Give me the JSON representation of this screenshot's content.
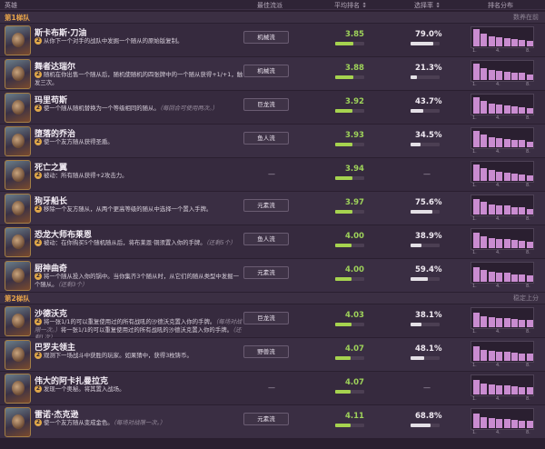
{
  "header": {
    "hero": "英雄",
    "comp": "最佳流派",
    "avg": "平均排名 ↕",
    "pick": "选择率 ↕",
    "dist": "排名分布"
  },
  "sections": [
    {
      "title": "第1梯队",
      "right": "数养在前"
    },
    {
      "title": "第2梯队",
      "right": "稳定上分"
    }
  ],
  "heroes": [
    {
      "name": "斯卡布斯·刀油",
      "desc": "从你下一个对手的战队中发掘一个随从的原始版复制。",
      "note": "",
      "comp": "机械流",
      "avg": "3.85",
      "avg_frac": 0.62,
      "pick": "79.0%",
      "pick_frac": 0.79,
      "dist": [
        0.95,
        0.7,
        0.55,
        0.5,
        0.45,
        0.4,
        0.35,
        0.3
      ]
    },
    {
      "name": "舞者达瑞尔",
      "desc": "随机在你出售一个随从后，随机使随机的四张牌中的一个随从获得+1/+1，触发三次。",
      "note": "",
      "comp": "机械流",
      "avg": "3.88",
      "avg_frac": 0.61,
      "pick": "21.3%",
      "pick_frac": 0.21,
      "dist": [
        0.9,
        0.65,
        0.55,
        0.5,
        0.45,
        0.42,
        0.38,
        0.3
      ]
    },
    {
      "name": "玛里苟斯",
      "desc": "使一个随从随机替换为一个等级相同的随从。",
      "note": "（每回合可使用两次。）",
      "comp": "巨龙流",
      "avg": "3.92",
      "avg_frac": 0.6,
      "pick": "43.7%",
      "pick_frac": 0.44,
      "dist": [
        0.9,
        0.68,
        0.55,
        0.48,
        0.45,
        0.42,
        0.35,
        0.28
      ]
    },
    {
      "name": "堕落的乔治",
      "desc": "使一个友方随从获得圣盾。",
      "note": "",
      "comp": "鱼人流",
      "avg": "3.93",
      "avg_frac": 0.6,
      "pick": "34.5%",
      "pick_frac": 0.35,
      "dist": [
        0.9,
        0.7,
        0.55,
        0.5,
        0.45,
        0.4,
        0.38,
        0.32
      ]
    },
    {
      "name": "死亡之翼",
      "desc": "被动：所有随从获得+2攻击力。",
      "note": "",
      "comp": "",
      "avg": "3.94",
      "avg_frac": 0.59,
      "pick": "",
      "pick_frac": 0,
      "dist": [
        0.88,
        0.7,
        0.58,
        0.5,
        0.45,
        0.42,
        0.35,
        0.3
      ]
    },
    {
      "name": "狗牙船长",
      "desc": "移除一个友方随从，从两个更高等级的随从中选择一个置入手牌。",
      "note": "",
      "comp": "元素流",
      "avg": "3.97",
      "avg_frac": 0.58,
      "pick": "75.6%",
      "pick_frac": 0.76,
      "dist": [
        0.85,
        0.68,
        0.55,
        0.5,
        0.48,
        0.42,
        0.38,
        0.32
      ]
    },
    {
      "name": "恐龙大师布莱恩",
      "desc": "被动：在你购买5个随机随从后，将布莱恩·铜须置入你的手牌。",
      "note": "（还剩5个）",
      "comp": "鱼人流",
      "avg": "4.00",
      "avg_frac": 0.56,
      "pick": "38.9%",
      "pick_frac": 0.39,
      "dist": [
        0.85,
        0.65,
        0.55,
        0.5,
        0.48,
        0.45,
        0.4,
        0.35
      ]
    },
    {
      "name": "厨神曲奇",
      "desc": "将一个随从投入你的锅中。当你集齐3个随从时，从它们的随从类型中发掘一个随从。",
      "note": "（还剩3个）",
      "comp": "元素流",
      "avg": "4.00",
      "avg_frac": 0.56,
      "pick": "59.4%",
      "pick_frac": 0.59,
      "dist": [
        0.82,
        0.65,
        0.55,
        0.52,
        0.48,
        0.42,
        0.4,
        0.35
      ]
    },
    {
      "name": "沙德沃克",
      "desc": "将一张1/1的可以重复使用过的所有战吼的沙德沃克置入你的手牌。",
      "note": "（每场对战限一次。）",
      "desc2": "将一张1/1的可以重复使用过的所有战吼的沙德沃克置入你的手牌。",
      "note2": "（还剩1次）",
      "comp": "巨龙流",
      "avg": "4.03",
      "avg_frac": 0.55,
      "pick": "38.1%",
      "pick_frac": 0.38,
      "dist": [
        0.82,
        0.62,
        0.55,
        0.5,
        0.48,
        0.45,
        0.42,
        0.38
      ]
    },
    {
      "name": "巴罗夫领主",
      "desc": "观测下一场战斗中获胜的玩家。如果猜中，获得3枚铸币。",
      "note": "",
      "comp": "野兽流",
      "avg": "4.07",
      "avg_frac": 0.53,
      "pick": "48.1%",
      "pick_frac": 0.48,
      "dist": [
        0.8,
        0.62,
        0.55,
        0.5,
        0.48,
        0.45,
        0.42,
        0.38
      ]
    },
    {
      "name": "伟大的阿卡扎曼拉克",
      "desc": "发现一个奥秘。将其置入战场。",
      "note": "",
      "comp": "",
      "avg": "4.07",
      "avg_frac": 0.53,
      "pick": "",
      "pick_frac": 0,
      "dist": [
        0.8,
        0.6,
        0.55,
        0.52,
        0.48,
        0.45,
        0.42,
        0.38
      ]
    },
    {
      "name": "雷诺·杰克逊",
      "desc": "使一个友方随从变成金色。",
      "note": "（每场对战限一次。）",
      "comp": "元素流",
      "avg": "4.11",
      "avg_frac": 0.52,
      "pick": "68.8%",
      "pick_frac": 0.69,
      "dist": [
        0.78,
        0.6,
        0.55,
        0.52,
        0.48,
        0.45,
        0.42,
        0.4
      ]
    }
  ],
  "dist_labels": [
    "1.",
    "4.",
    "8."
  ],
  "dash": "—"
}
